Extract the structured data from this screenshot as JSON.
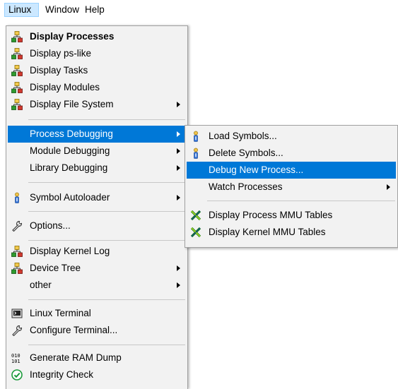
{
  "menubar": {
    "items": [
      {
        "label": "Linux"
      },
      {
        "label": "Window"
      },
      {
        "label": "Help"
      }
    ]
  },
  "main_menu": {
    "items": [
      {
        "label": "Display Processes",
        "icon": "process-tree-icon"
      },
      {
        "label": "Display ps-like",
        "icon": "process-tree-icon"
      },
      {
        "label": "Display Tasks",
        "icon": "process-tree-icon"
      },
      {
        "label": "Display Modules",
        "icon": "process-tree-icon"
      },
      {
        "label": "Display File System",
        "icon": "process-tree-icon"
      },
      {
        "label": "Process Debugging"
      },
      {
        "label": "Module Debugging"
      },
      {
        "label": "Library Debugging"
      },
      {
        "label": "Symbol Autoloader",
        "icon": "info-person-icon"
      },
      {
        "label": "Options...",
        "icon": "wrench-icon"
      },
      {
        "label": "Display Kernel Log",
        "icon": "process-tree-icon"
      },
      {
        "label": "Device Tree",
        "icon": "process-tree-icon"
      },
      {
        "label": "other"
      },
      {
        "label": "Linux Terminal",
        "icon": "terminal-icon"
      },
      {
        "label": "Configure Terminal...",
        "icon": "wrench-icon"
      },
      {
        "label": "Generate RAM Dump",
        "icon": "binary-icon"
      },
      {
        "label": "Integrity Check",
        "icon": "check-circle-icon"
      }
    ]
  },
  "submenu": {
    "items": [
      {
        "label": "Load Symbols...",
        "icon": "info-person-icon"
      },
      {
        "label": "Delete Symbols...",
        "icon": "info-person-icon"
      },
      {
        "label": "Debug New Process..."
      },
      {
        "label": "Watch Processes"
      },
      {
        "label": "Display Process MMU Tables",
        "icon": "mmu-table-icon"
      },
      {
        "label": "Display Kernel MMU Tables",
        "icon": "mmu-table-icon"
      }
    ]
  },
  "colors": {
    "highlight": "#0078d7",
    "menu_bg": "#f2f2f2",
    "menubar_active": "#cce8ff"
  }
}
